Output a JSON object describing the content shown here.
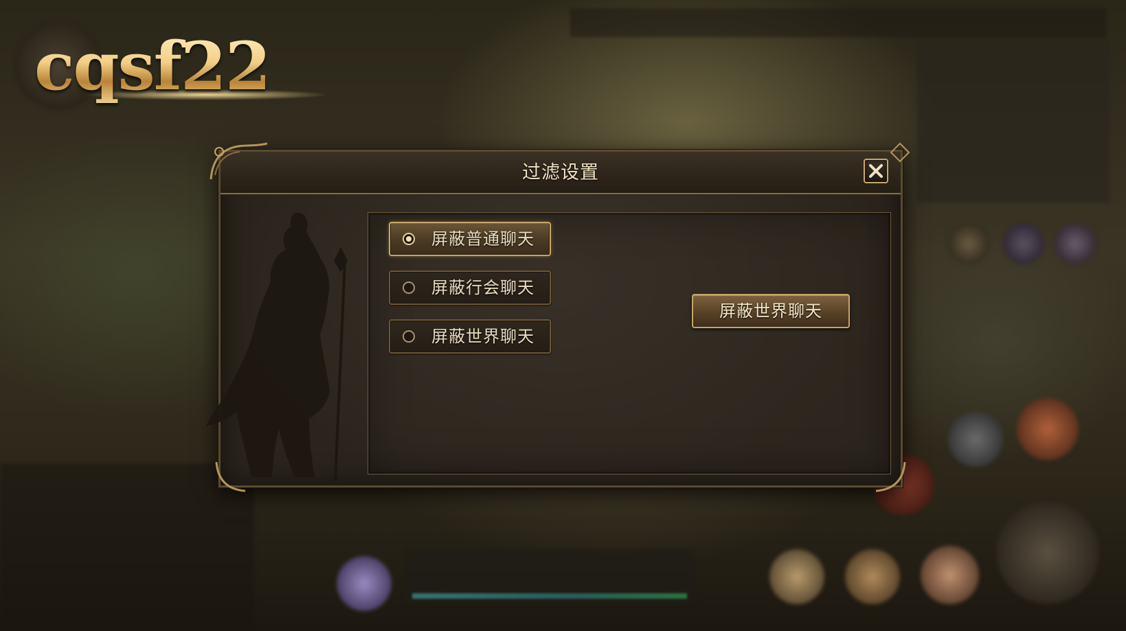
{
  "logo": {
    "text": "cqsf22"
  },
  "dialog": {
    "title": "过滤设置",
    "options": [
      {
        "label": "屏蔽普通聊天",
        "selected": true
      },
      {
        "label": "屏蔽行会聊天",
        "selected": false
      },
      {
        "label": "屏蔽世界聊天",
        "selected": false
      }
    ],
    "action_button": {
      "label": "屏蔽世界聊天"
    }
  },
  "colors": {
    "accent_gold": "#c9a466",
    "panel_bg": "#2f281f",
    "text": "#e9dcc0"
  }
}
